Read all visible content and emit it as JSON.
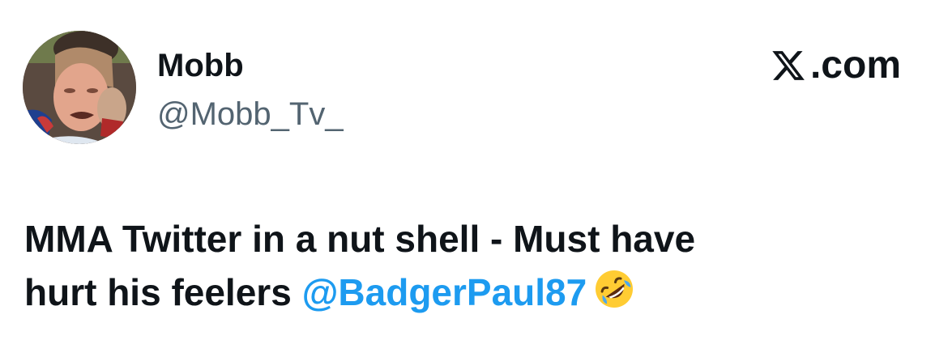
{
  "author": {
    "display_name": "Mobb",
    "handle": "@Mobb_Tv_",
    "avatar_icon": "profile-photo-avatar"
  },
  "brand": {
    "logo_icon": "x-logo-icon",
    "domain_text": ".com"
  },
  "tweet": {
    "text_line_1": "MMA Twitter in a nut shell - Must have",
    "text_line_2_prefix": "hurt his feelers ",
    "mention": "@BadgerPaul87",
    "emoji": "🤣",
    "emoji_icon": "rolling-on-floor-laughing-emoji"
  },
  "colors": {
    "text": "#0f1419",
    "secondary": "#536471",
    "link": "#1d9bf0",
    "background": "#ffffff"
  }
}
